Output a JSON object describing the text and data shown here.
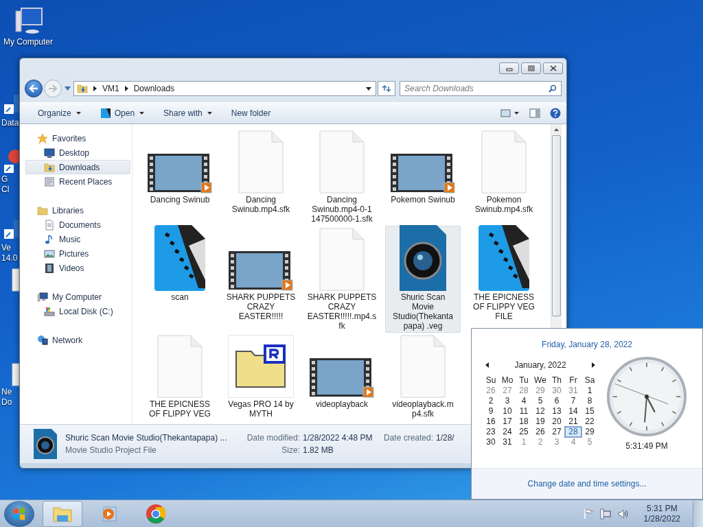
{
  "desktop_icons": [
    {
      "kind": "computer",
      "lines": [
        "My Computer"
      ]
    },
    {
      "kind": "shortcut",
      "lines": [
        "Data"
      ]
    },
    {
      "kind": "chrome",
      "lines": [
        "G",
        "Cl"
      ]
    },
    {
      "kind": "shortcut",
      "lines": [
        "Ve",
        "14.0"
      ]
    },
    {
      "kind": "document"
    },
    {
      "kind": "document",
      "lines": [
        "Ne",
        "Do"
      ]
    }
  ],
  "window": {
    "address": [
      "VM1",
      "Downloads"
    ],
    "search": {
      "placeholder": "Search Downloads"
    },
    "toolbar": [
      {
        "label": "Organize",
        "kind": "menu"
      },
      {
        "label": "Open",
        "kind": "open"
      },
      {
        "label": "Share with",
        "kind": "menu"
      },
      {
        "label": "New folder",
        "kind": "plain"
      }
    ],
    "sidebar": {
      "groups": [
        {
          "label": "Favorites",
          "kind": "favorites",
          "children": [
            {
              "label": "Desktop",
              "kind": "desktop",
              "selected": false
            },
            {
              "label": "Downloads",
              "kind": "downloads",
              "selected": true
            },
            {
              "label": "Recent Places",
              "kind": "recent",
              "selected": false
            }
          ]
        },
        {
          "label": "Libraries",
          "kind": "libraries",
          "children": [
            {
              "label": "Documents",
              "kind": "documents",
              "selected": false
            },
            {
              "label": "Music",
              "kind": "music",
              "selected": false
            },
            {
              "label": "Pictures",
              "kind": "pictures",
              "selected": false
            },
            {
              "label": "Videos",
              "kind": "videos",
              "selected": false
            }
          ]
        },
        {
          "label": "My Computer",
          "kind": "computer",
          "children": [
            {
              "label": "Local Disk (C:)",
              "kind": "disk",
              "selected": false
            }
          ]
        },
        {
          "label": "Network",
          "kind": "network"
        }
      ]
    },
    "files": [
      {
        "kind": "video",
        "lines": [
          "Dancing Swinub"
        ],
        "selected": false
      },
      {
        "kind": "blank",
        "lines": [
          "Dancing",
          "Swinub.mp4.sfk"
        ],
        "selected": false
      },
      {
        "kind": "blank",
        "lines": [
          "Dancing",
          "Swinub.mp4-0-1",
          "147500000-1.sfk"
        ],
        "selected": false
      },
      {
        "kind": "video",
        "lines": [
          "Pokemon Swinub"
        ],
        "selected": false
      },
      {
        "kind": "blank",
        "lines": [
          "Pokemon",
          "Swinub.mp4.sfk"
        ],
        "selected": false
      },
      {
        "kind": "vegas",
        "lines": [
          "scan"
        ],
        "selected": false
      },
      {
        "kind": "video",
        "lines": [
          "SHARK PUPPETS",
          "CRAZY",
          "EASTER!!!!!"
        ],
        "selected": false
      },
      {
        "kind": "blank",
        "lines": [
          "SHARK PUPPETS",
          "CRAZY",
          "EASTER!!!!!.mp4.s",
          "fk"
        ],
        "selected": false
      },
      {
        "kind": "lens",
        "lines": [
          "Shuric Scan",
          "Movie",
          "Studio(Thekanta",
          "papa) .veg"
        ],
        "selected": true
      },
      {
        "kind": "vegas",
        "lines": [
          "THE EPICNESS",
          "OF FLIPPY VEG",
          "FILE"
        ],
        "selected": false
      },
      {
        "kind": "blank",
        "lines": [
          "THE EPICNESS",
          "OF FLIPPY VEG"
        ],
        "selected": false
      },
      {
        "kind": "folder",
        "lines": [
          "Vegas PRO 14 by",
          "MYTH"
        ],
        "selected": false
      },
      {
        "kind": "video",
        "lines": [
          "videoplayback"
        ],
        "selected": false
      },
      {
        "kind": "blank",
        "lines": [
          "videoplayback.m",
          "p4.sfk"
        ],
        "selected": false
      }
    ],
    "details": {
      "name": "Shuric Scan Movie Studio(Thekantapapa) ...",
      "type": "Movie Studio Project File",
      "fields": [
        {
          "label": "Date modified:",
          "value": "1/28/2022 4:48 PM"
        },
        {
          "label": "Date created:",
          "value": "1/28/"
        },
        {
          "label": "Size:",
          "value": "1.82 MB"
        }
      ]
    }
  },
  "calendar_popup": {
    "date_heading": "Friday, January 28, 2022",
    "month": "January, 2022",
    "weekdays": [
      "Su",
      "Mo",
      "Tu",
      "We",
      "Th",
      "Fr",
      "Sa"
    ],
    "weeks": [
      [
        {
          "d": "26",
          "other": true,
          "selected": false
        },
        {
          "d": "27",
          "other": true,
          "selected": false
        },
        {
          "d": "28",
          "other": true,
          "selected": false
        },
        {
          "d": "29",
          "other": true,
          "selected": false
        },
        {
          "d": "30",
          "other": true,
          "selected": false
        },
        {
          "d": "31",
          "other": true,
          "selected": false
        },
        {
          "d": "1",
          "other": false,
          "selected": false
        }
      ],
      [
        {
          "d": "2",
          "other": false,
          "selected": false
        },
        {
          "d": "3",
          "other": false,
          "selected": false
        },
        {
          "d": "4",
          "other": false,
          "selected": false
        },
        {
          "d": "5",
          "other": false,
          "selected": false
        },
        {
          "d": "6",
          "other": false,
          "selected": false
        },
        {
          "d": "7",
          "other": false,
          "selected": false
        },
        {
          "d": "8",
          "other": false,
          "selected": false
        }
      ],
      [
        {
          "d": "9",
          "other": false,
          "selected": false
        },
        {
          "d": "10",
          "other": false,
          "selected": false
        },
        {
          "d": "11",
          "other": false,
          "selected": false
        },
        {
          "d": "12",
          "other": false,
          "selected": false
        },
        {
          "d": "13",
          "other": false,
          "selected": false
        },
        {
          "d": "14",
          "other": false,
          "selected": false
        },
        {
          "d": "15",
          "other": false,
          "selected": false
        }
      ],
      [
        {
          "d": "16",
          "other": false,
          "selected": false
        },
        {
          "d": "17",
          "other": false,
          "selected": false
        },
        {
          "d": "18",
          "other": false,
          "selected": false
        },
        {
          "d": "19",
          "other": false,
          "selected": false
        },
        {
          "d": "20",
          "other": false,
          "selected": false
        },
        {
          "d": "21",
          "other": false,
          "selected": false
        },
        {
          "d": "22",
          "other": false,
          "selected": false
        }
      ],
      [
        {
          "d": "23",
          "other": false,
          "selected": false
        },
        {
          "d": "24",
          "other": false,
          "selected": false
        },
        {
          "d": "25",
          "other": false,
          "selected": false
        },
        {
          "d": "26",
          "other": false,
          "selected": false
        },
        {
          "d": "27",
          "other": false,
          "selected": false
        },
        {
          "d": "28",
          "other": false,
          "selected": true
        },
        {
          "d": "29",
          "other": false,
          "selected": false
        }
      ],
      [
        {
          "d": "30",
          "other": false,
          "selected": false
        },
        {
          "d": "31",
          "other": false,
          "selected": false
        },
        {
          "d": "1",
          "other": true,
          "selected": false
        },
        {
          "d": "2",
          "other": true,
          "selected": false
        },
        {
          "d": "3",
          "other": true,
          "selected": false
        },
        {
          "d": "4",
          "other": true,
          "selected": false
        },
        {
          "d": "5",
          "other": true,
          "selected": false
        }
      ]
    ],
    "time": "5:31:49 PM",
    "settings_link": "Change date and time settings..."
  },
  "taskbar": {
    "apps": [
      {
        "kind": "explorer",
        "active": true
      },
      {
        "kind": "media",
        "active": false
      },
      {
        "kind": "chrome",
        "active": false
      }
    ],
    "clock": {
      "time": "5:31 PM",
      "date": "1/28/2022"
    }
  }
}
